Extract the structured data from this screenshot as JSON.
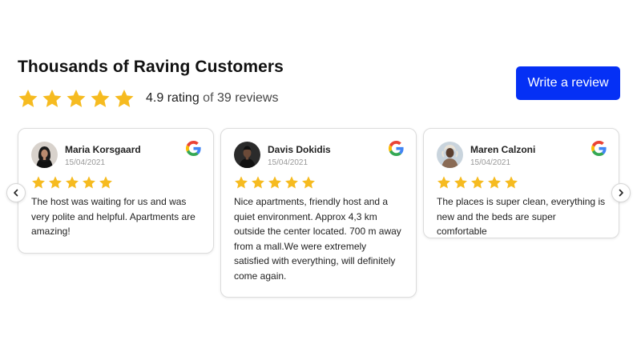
{
  "header": {
    "title": "Thousands of Raving Customers",
    "rating_value": "4.9 rating",
    "rating_of": "of",
    "review_count": "39 reviews",
    "stars": 5,
    "write_review_label": "Write a review"
  },
  "colors": {
    "accent": "#0530f5",
    "star": "#f6bb20",
    "card_border": "#dcdcdc"
  },
  "reviews": [
    {
      "author": "Maria Korsgaard",
      "date": "15/04/2021",
      "rating": 5,
      "source_icon": "google-icon",
      "text": "The host was waiting for us and was very polite and helpful. Apartments are amazing!"
    },
    {
      "author": "Davis Dokidis",
      "date": "15/04/2021",
      "rating": 5,
      "source_icon": "google-icon",
      "text": "Nice apartments, friendly host and a quiet environment. Approx 4,3 km outside the center located. 700 m away from a mall.We were extremely satisfied with everything, will definitely come again."
    },
    {
      "author": "Maren Calzoni",
      "date": "15/04/2021",
      "rating": 5,
      "source_icon": "google-icon",
      "text": "The places is super clean, everything is new and the beds are super comfortable"
    }
  ],
  "navigation": {
    "prev_icon": "chevron-left-icon",
    "next_icon": "chevron-right-icon"
  }
}
